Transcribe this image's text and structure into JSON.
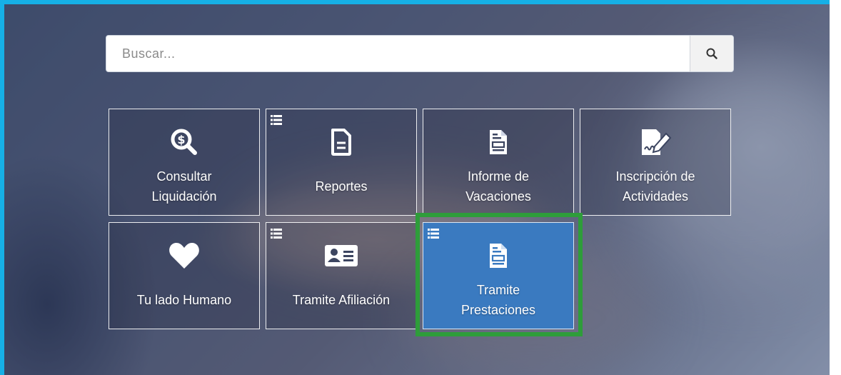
{
  "search": {
    "placeholder": "Buscar...",
    "icon": "search-icon"
  },
  "tiles": [
    {
      "line1": "Consultar",
      "line2": "Liquidación",
      "icon": "money-search-icon",
      "has_menu": false,
      "active": false
    },
    {
      "line1": "Reportes",
      "line2": "",
      "icon": "document-icon",
      "has_menu": true,
      "active": false
    },
    {
      "line1": "Informe de",
      "line2": "Vacaciones",
      "icon": "form-document-icon",
      "has_menu": false,
      "active": false
    },
    {
      "line1": "Inscripción de",
      "line2": "Actividades",
      "icon": "signature-edit-icon",
      "has_menu": false,
      "active": false
    },
    {
      "line1": "Tu lado Humano",
      "line2": "",
      "icon": "heart-icon",
      "has_menu": false,
      "active": false
    },
    {
      "line1": "Tramite Afiliación",
      "line2": "",
      "icon": "id-card-icon",
      "has_menu": true,
      "active": false
    },
    {
      "line1": "Tramite",
      "line2": "Prestaciones",
      "icon": "form-document-icon",
      "has_menu": true,
      "active": true
    }
  ],
  "colors": {
    "frame": "#16b0e6",
    "active_tile": "#3a7ac0",
    "highlight": "#2e9d3a"
  }
}
